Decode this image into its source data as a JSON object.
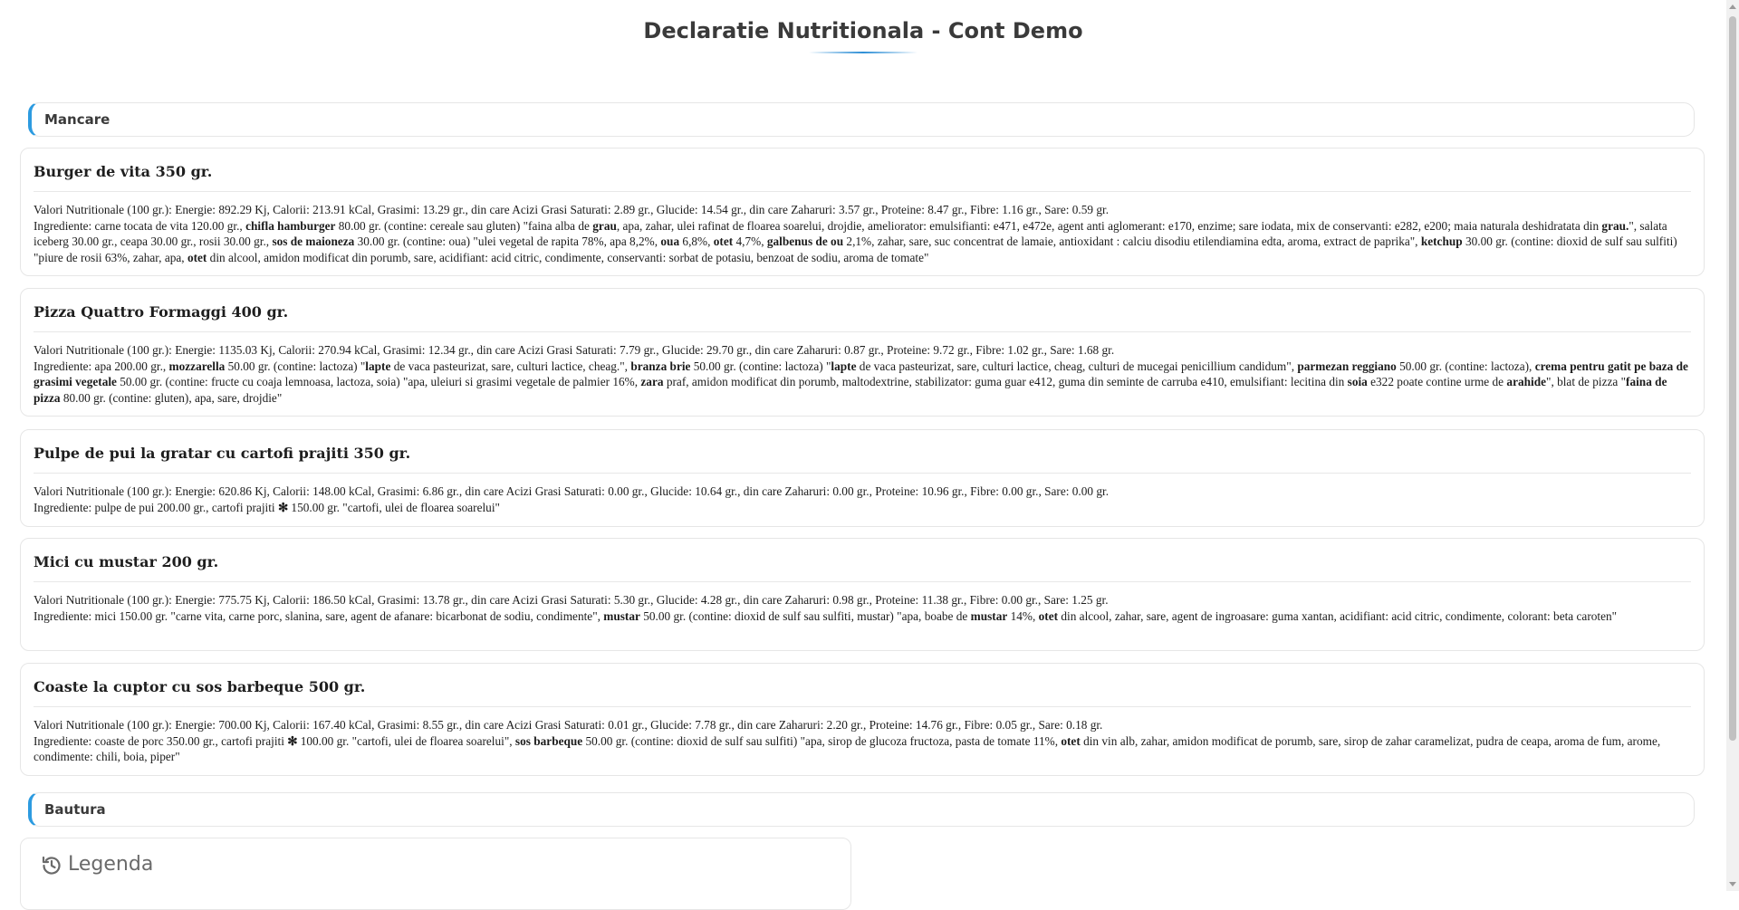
{
  "page": {
    "title": "Declaratie Nutritionala - Cont Demo"
  },
  "sections": {
    "food": "Mancare",
    "drinks": "Bautura"
  },
  "legend": {
    "label": "Legenda",
    "icon": "history-icon"
  },
  "items": [
    {
      "title": "Burger de vita 350 gr.",
      "nutrition": "Valori Nutritionale (100 gr.): Energie: 892.29 Kj, Calorii: 213.91 kCal, Grasimi: 13.29 gr., din care Acizi Grasi Saturati: 2.89 gr., Glucide: 14.54 gr., din care Zaharuri: 3.57 gr., Proteine: 8.47 gr., Fibre: 1.16 gr., Sare: 0.59 gr.",
      "ingredients": [
        {
          "t": "Ingrediente: carne tocata de vita 120.00 gr., "
        },
        {
          "t": "chifla hamburger",
          "b": true
        },
        {
          "t": " 80.00 gr. (contine: cereale sau gluten) \"faina alba de "
        },
        {
          "t": "grau",
          "b": true
        },
        {
          "t": ", apa, zahar, ulei rafinat de floarea soarelui, drojdie, ameliorator: emulsifianti: e471, e472e, agent anti aglomerant: e170, enzime; sare iodata, mix de conservanti: e282, e200; maia naturala deshidratata din "
        },
        {
          "t": "grau.",
          "b": true
        },
        {
          "t": "\", salata iceberg 30.00 gr., ceapa 30.00 gr., rosii 30.00 gr., "
        },
        {
          "t": "sos de maioneza",
          "b": true
        },
        {
          "t": " 30.00 gr. (contine: oua) \"ulei vegetal de rapita 78%, apa 8,2%, "
        },
        {
          "t": "oua",
          "b": true
        },
        {
          "t": " 6,8%, "
        },
        {
          "t": "otet",
          "b": true
        },
        {
          "t": " 4,7%, "
        },
        {
          "t": "galbenus de ou",
          "b": true
        },
        {
          "t": " 2,1%, zahar, sare, suc concentrat de lamaie, antioxidant : calciu disodiu etilendiamina edta, aroma, extract de paprika\", "
        },
        {
          "t": "ketchup",
          "b": true
        },
        {
          "t": " 30.00 gr. (contine: dioxid de sulf sau sulfiti) \"piure de rosii 63%, zahar, apa, "
        },
        {
          "t": "otet",
          "b": true
        },
        {
          "t": " din alcool, amidon modificat din porumb, sare, acidifiant: acid citric, condimente, conservanti: sorbat de potasiu, benzoat de sodiu, aroma de tomate\""
        }
      ]
    },
    {
      "title": "Pizza Quattro Formaggi 400 gr.",
      "nutrition": "Valori Nutritionale (100 gr.): Energie: 1135.03 Kj, Calorii: 270.94 kCal, Grasimi: 12.34 gr., din care Acizi Grasi Saturati: 7.79 gr., Glucide: 29.70 gr., din care Zaharuri: 0.87 gr., Proteine: 9.72 gr., Fibre: 1.02 gr., Sare: 1.68 gr.",
      "ingredients": [
        {
          "t": "Ingrediente: apa 200.00 gr., "
        },
        {
          "t": "mozzarella",
          "b": true
        },
        {
          "t": " 50.00 gr. (contine: lactoza) \""
        },
        {
          "t": "lapte",
          "b": true
        },
        {
          "t": " de vaca pasteurizat, sare, culturi lactice, cheag.\", "
        },
        {
          "t": "branza brie",
          "b": true
        },
        {
          "t": " 50.00 gr. (contine: lactoza) \""
        },
        {
          "t": "lapte",
          "b": true
        },
        {
          "t": " de vaca pasteurizat, sare, culturi lactice, cheag, culturi de mucegai penicillium candidum\", "
        },
        {
          "t": "parmezan reggiano",
          "b": true
        },
        {
          "t": " 50.00 gr. (contine: lactoza), "
        },
        {
          "t": "crema pentru gatit pe baza de grasimi vegetale",
          "b": true
        },
        {
          "t": " 50.00 gr. (contine: fructe cu coaja lemnoasa, lactoza, soia) \"apa, uleiuri si grasimi vegetale de palmier 16%, "
        },
        {
          "t": "zara",
          "b": true
        },
        {
          "t": " praf, amidon modificat din porumb, maltodextrine, stabilizator: guma guar e412, guma din seminte de carruba e410, emulsifiant: lecitina din "
        },
        {
          "t": "soia",
          "b": true
        },
        {
          "t": " e322 poate contine urme de "
        },
        {
          "t": "arahide",
          "b": true
        },
        {
          "t": "\", blat de pizza \""
        },
        {
          "t": "faina de pizza",
          "b": true
        },
        {
          "t": " 80.00 gr. (contine: gluten), apa, sare, drojdie\""
        }
      ]
    },
    {
      "title": "Pulpe de pui la gratar cu cartofi prajiti 350 gr.",
      "nutrition": "Valori Nutritionale (100 gr.): Energie: 620.86 Kj, Calorii: 148.00 kCal, Grasimi: 6.86 gr., din care Acizi Grasi Saturati: 0.00 gr., Glucide: 10.64 gr., din care Zaharuri: 0.00 gr., Proteine: 10.96 gr., Fibre: 0.00 gr., Sare: 0.00 gr.",
      "ingredients": [
        {
          "t": "Ingrediente: pulpe de pui 200.00 gr., cartofi prajiti "
        },
        {
          "t": "✻",
          "b": true
        },
        {
          "t": " 150.00 gr. \"cartofi, ulei de floarea soarelui\""
        }
      ]
    },
    {
      "title": "Mici cu mustar 200 gr.",
      "nutrition": "Valori Nutritionale (100 gr.): Energie: 775.75 Kj, Calorii: 186.50 kCal, Grasimi: 13.78 gr., din care Acizi Grasi Saturati: 5.30 gr., Glucide: 4.28 gr., din care Zaharuri: 0.98 gr., Proteine: 11.38 gr., Fibre: 0.00 gr., Sare: 1.25 gr.",
      "ingredients": [
        {
          "t": "Ingrediente: mici 150.00 gr. \"carne vita, carne porc, slanina, sare, agent de afanare: bicarbonat de sodiu, condimente\", "
        },
        {
          "t": "mustar",
          "b": true
        },
        {
          "t": " 50.00 gr. (contine: dioxid de sulf sau sulfiti, mustar) \"apa, boabe de "
        },
        {
          "t": "mustar",
          "b": true
        },
        {
          "t": " 14%, "
        },
        {
          "t": "otet",
          "b": true
        },
        {
          "t": " din alcool, zahar, sare, agent de ingroasare: guma xantan, acidifiant: acid citric, condimente, colorant: beta caroten\""
        }
      ]
    },
    {
      "title": "Coaste la cuptor cu sos barbeque 500 gr.",
      "nutrition": "Valori Nutritionale (100 gr.): Energie: 700.00 Kj, Calorii: 167.40 kCal, Grasimi: 8.55 gr., din care Acizi Grasi Saturati: 0.01 gr., Glucide: 7.78 gr., din care Zaharuri: 2.20 gr., Proteine: 14.76 gr., Fibre: 0.05 gr., Sare: 0.18 gr.",
      "ingredients": [
        {
          "t": "Ingrediente: coaste de porc 350.00 gr., cartofi prajiti "
        },
        {
          "t": "✻",
          "b": true
        },
        {
          "t": " 100.00 gr. \"cartofi, ulei de floarea soarelui\", "
        },
        {
          "t": "sos barbeque",
          "b": true
        },
        {
          "t": " 50.00 gr. (contine: dioxid de sulf sau sulfiti) \"apa, sirop de glucoza fructoza, pasta de tomate 11%, "
        },
        {
          "t": "otet",
          "b": true
        },
        {
          "t": " din vin alb, zahar, amidon modificat de porumb, sare, sirop de zahar caramelizat, pudra de ceapa, aroma de fum, arome, condimente: chili, boia, piper\""
        }
      ]
    }
  ]
}
